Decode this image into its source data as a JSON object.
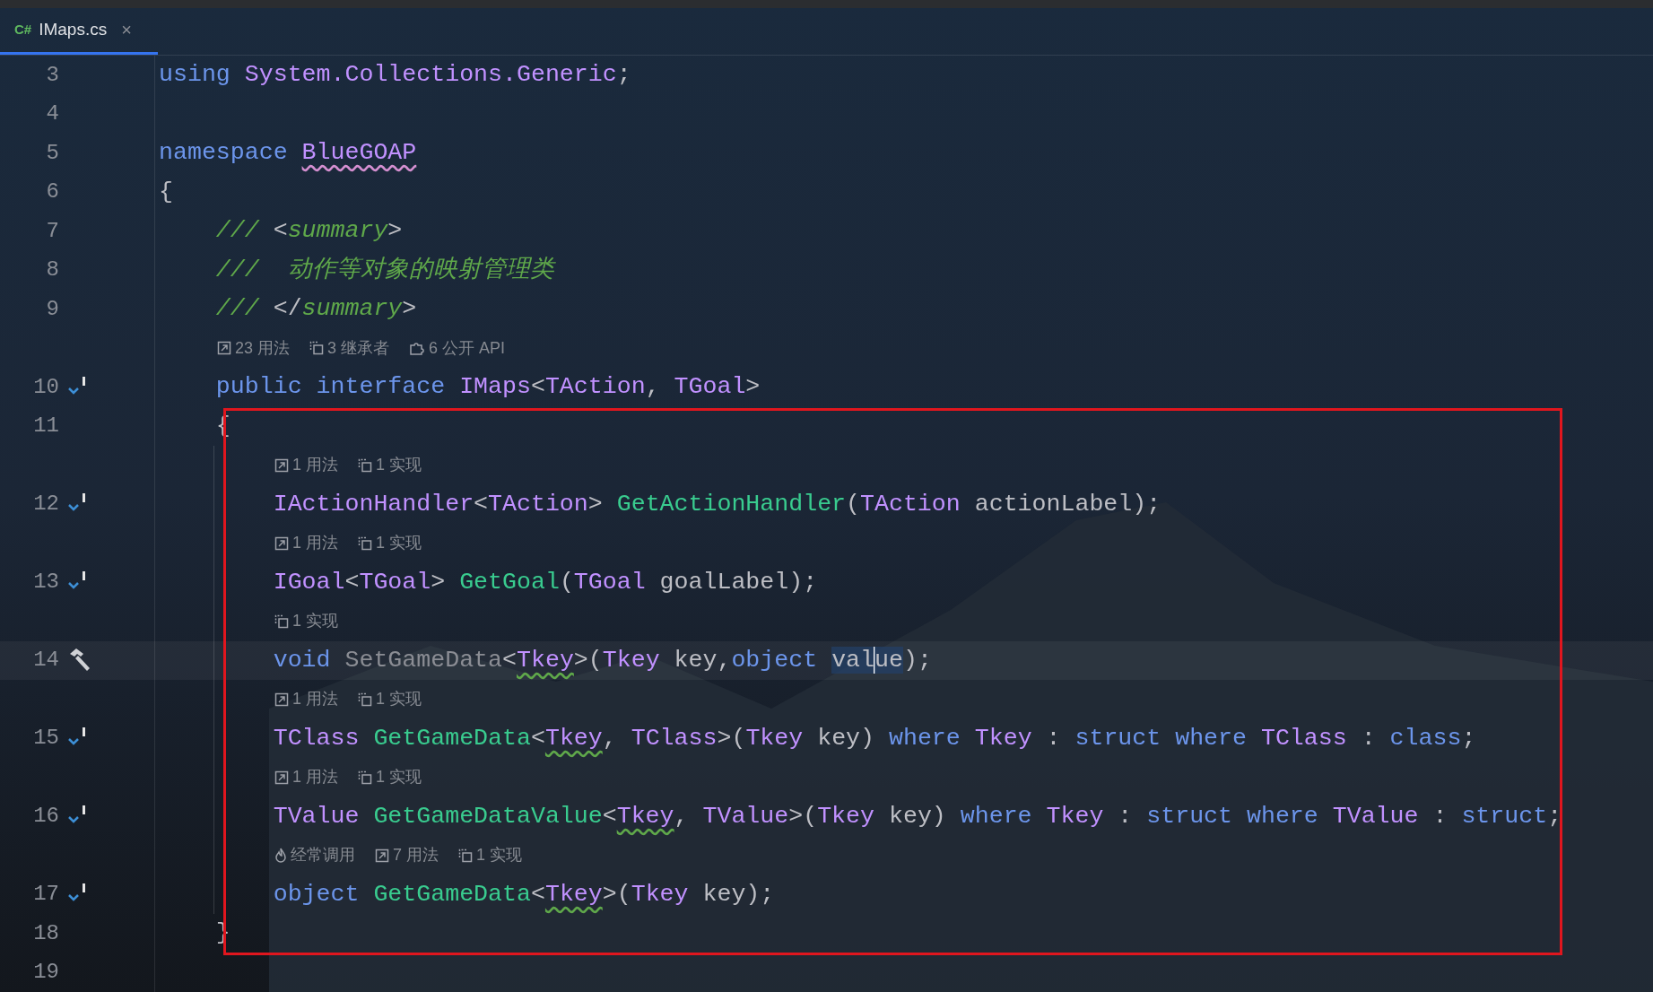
{
  "tabs": [
    {
      "lang_badge": "C#",
      "label": "IMaps.cs",
      "close": "×",
      "selected": true
    }
  ],
  "lines": [
    {
      "number": "3",
      "tokens": [
        {
          "text": "using ",
          "kind": "keyword"
        },
        {
          "text": "System.Collections.Generic",
          "kind": "type"
        },
        {
          "text": ";",
          "kind": "plain"
        }
      ]
    },
    {
      "number": "4"
    },
    {
      "number": "5",
      "tokens": [
        {
          "text": "namespace ",
          "kind": "keyword"
        },
        {
          "text": "BlueGOAP",
          "kind": "type",
          "typo": true
        }
      ]
    },
    {
      "number": "6",
      "tokens": [
        {
          "text": "{",
          "kind": "plain"
        }
      ]
    },
    {
      "number": "7",
      "tokens": [
        {
          "text": "    /// ",
          "kind": "comment"
        },
        {
          "text": "<",
          "kind": "plain"
        },
        {
          "text": "summary",
          "kind": "comment"
        },
        {
          "text": ">",
          "kind": "plain"
        }
      ]
    },
    {
      "number": "8",
      "tokens": [
        {
          "text": "    ///  动作等对象的映射管理类",
          "kind": "comment"
        }
      ]
    },
    {
      "number": "9",
      "tokens": [
        {
          "text": "    /// ",
          "kind": "comment"
        },
        {
          "text": "</",
          "kind": "plain"
        },
        {
          "text": "summary",
          "kind": "comment"
        },
        {
          "text": ">",
          "kind": "plain"
        }
      ]
    },
    {
      "number": "10",
      "gutter": {
        "kind": "implemented"
      },
      "hints": [
        {
          "kind": "usages",
          "text": "23 用法"
        },
        {
          "kind": "inheritors",
          "text": "3 继承者"
        },
        {
          "kind": "api",
          "text": "6 公开 API"
        }
      ],
      "tokens": [
        {
          "text": "    public interface ",
          "kind": "keyword"
        },
        {
          "text": "IMaps",
          "kind": "type"
        },
        {
          "text": "<",
          "kind": "plain"
        },
        {
          "text": "TAction",
          "kind": "type"
        },
        {
          "text": ", ",
          "kind": "plain"
        },
        {
          "text": "TGoal",
          "kind": "type"
        },
        {
          "text": ">",
          "kind": "plain"
        }
      ]
    },
    {
      "number": "11",
      "tokens": [
        {
          "text": "    {",
          "kind": "plain"
        }
      ]
    },
    {
      "number": "12",
      "gutter": {
        "kind": "implemented"
      },
      "hints": [
        {
          "kind": "usages",
          "text": "1 用法"
        },
        {
          "kind": "inheritors",
          "text": "1 实现"
        }
      ],
      "tokens": [
        {
          "text": "        IActionHandler",
          "kind": "type"
        },
        {
          "text": "<",
          "kind": "plain"
        },
        {
          "text": "TAction",
          "kind": "type"
        },
        {
          "text": "> ",
          "kind": "plain"
        },
        {
          "text": "GetActionHandler",
          "kind": "method"
        },
        {
          "text": "(",
          "kind": "plain"
        },
        {
          "text": "TAction",
          "kind": "type"
        },
        {
          "text": " actionLabel);",
          "kind": "plain"
        }
      ]
    },
    {
      "number": "13",
      "gutter": {
        "kind": "implemented"
      },
      "hints": [
        {
          "kind": "usages",
          "text": "1 用法"
        },
        {
          "kind": "inheritors",
          "text": "1 实现"
        }
      ],
      "tokens": [
        {
          "text": "        IGoal",
          "kind": "type"
        },
        {
          "text": "<",
          "kind": "plain"
        },
        {
          "text": "TGoal",
          "kind": "type"
        },
        {
          "text": "> ",
          "kind": "plain"
        },
        {
          "text": "GetGoal",
          "kind": "method"
        },
        {
          "text": "(",
          "kind": "plain"
        },
        {
          "text": "TGoal",
          "kind": "type"
        },
        {
          "text": " goalLabel);",
          "kind": "plain"
        }
      ]
    },
    {
      "number": "14",
      "gutter": {
        "kind": "hammer"
      },
      "current": true,
      "hints": [
        {
          "kind": "inheritors",
          "text": "1 实现"
        }
      ],
      "tokens": [
        {
          "text": "        void ",
          "kind": "keyword"
        },
        {
          "text": "SetGameData",
          "kind": "unused"
        },
        {
          "text": "<",
          "kind": "plain"
        },
        {
          "text": "Tkey",
          "kind": "type",
          "warning": true
        },
        {
          "text": ">(",
          "kind": "plain"
        },
        {
          "text": "Tkey",
          "kind": "type"
        },
        {
          "text": " key,",
          "kind": "plain"
        },
        {
          "text": "object ",
          "kind": "keyword"
        },
        {
          "text": "val",
          "kind": "plain",
          "highlight": true,
          "caret": true
        },
        {
          "text": "ue",
          "kind": "plain",
          "highlight": true
        },
        {
          "text": ");",
          "kind": "plain"
        }
      ]
    },
    {
      "number": "15",
      "gutter": {
        "kind": "implemented"
      },
      "hints": [
        {
          "kind": "usages",
          "text": "1 用法"
        },
        {
          "kind": "inheritors",
          "text": "1 实现"
        }
      ],
      "tokens": [
        {
          "text": "        TClass ",
          "kind": "type"
        },
        {
          "text": "GetGameData",
          "kind": "method"
        },
        {
          "text": "<",
          "kind": "plain"
        },
        {
          "text": "Tkey",
          "kind": "type",
          "warning": true
        },
        {
          "text": ", ",
          "kind": "plain"
        },
        {
          "text": "TClass",
          "kind": "type"
        },
        {
          "text": ">(",
          "kind": "plain"
        },
        {
          "text": "Tkey",
          "kind": "type"
        },
        {
          "text": " key) ",
          "kind": "plain"
        },
        {
          "text": "where ",
          "kind": "keyword"
        },
        {
          "text": "Tkey",
          "kind": "type"
        },
        {
          "text": " : ",
          "kind": "plain"
        },
        {
          "text": "struct where ",
          "kind": "keyword"
        },
        {
          "text": "TClass",
          "kind": "type"
        },
        {
          "text": " : ",
          "kind": "plain"
        },
        {
          "text": "class",
          "kind": "keyword"
        },
        {
          "text": ";",
          "kind": "plain"
        }
      ]
    },
    {
      "number": "16",
      "gutter": {
        "kind": "implemented"
      },
      "hints": [
        {
          "kind": "usages",
          "text": "1 用法"
        },
        {
          "kind": "inheritors",
          "text": "1 实现"
        }
      ],
      "tokens": [
        {
          "text": "        TValue ",
          "kind": "type"
        },
        {
          "text": "GetGameDataValue",
          "kind": "method"
        },
        {
          "text": "<",
          "kind": "plain"
        },
        {
          "text": "Tkey",
          "kind": "type",
          "warning": true
        },
        {
          "text": ", ",
          "kind": "plain"
        },
        {
          "text": "TValue",
          "kind": "type"
        },
        {
          "text": ">(",
          "kind": "plain"
        },
        {
          "text": "Tkey",
          "kind": "type"
        },
        {
          "text": " key) ",
          "kind": "plain"
        },
        {
          "text": "where ",
          "kind": "keyword"
        },
        {
          "text": "Tkey",
          "kind": "type"
        },
        {
          "text": " : ",
          "kind": "plain"
        },
        {
          "text": "struct where ",
          "kind": "keyword"
        },
        {
          "text": "TValue",
          "kind": "type"
        },
        {
          "text": " : ",
          "kind": "plain"
        },
        {
          "text": "struct",
          "kind": "keyword"
        },
        {
          "text": ";",
          "kind": "plain"
        }
      ]
    },
    {
      "number": "17",
      "gutter": {
        "kind": "implemented"
      },
      "hints": [
        {
          "kind": "hot",
          "text": "经常调用"
        },
        {
          "kind": "usages",
          "text": "7 用法"
        },
        {
          "kind": "inheritors",
          "text": "1 实现"
        }
      ],
      "tokens": [
        {
          "text": "        object ",
          "kind": "keyword"
        },
        {
          "text": "GetGameData",
          "kind": "method"
        },
        {
          "text": "<",
          "kind": "plain"
        },
        {
          "text": "Tkey",
          "kind": "type",
          "warning": true
        },
        {
          "text": ">(",
          "kind": "plain"
        },
        {
          "text": "Tkey",
          "kind": "type"
        },
        {
          "text": " key);",
          "kind": "plain"
        }
      ]
    },
    {
      "number": "18",
      "tokens": [
        {
          "text": "    }",
          "kind": "plain"
        }
      ]
    },
    {
      "number": "19"
    }
  ]
}
